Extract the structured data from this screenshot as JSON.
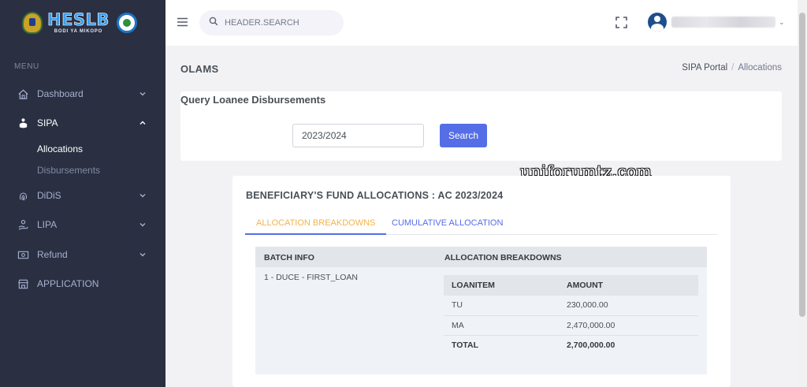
{
  "logo": {
    "title": "HESLB",
    "tagline": "BODI YA MIKOPO"
  },
  "sidebar": {
    "menu_title": "MENU",
    "items": [
      {
        "label": "Dashboard",
        "icon": "home-icon",
        "expanded": false
      },
      {
        "label": "SIPA",
        "icon": "sipa-person-icon",
        "expanded": true,
        "children": [
          {
            "label": "Allocations",
            "active": true
          },
          {
            "label": "Disbursements",
            "active": false
          }
        ]
      },
      {
        "label": "DiDiS",
        "icon": "fingerprint-icon",
        "expanded": false
      },
      {
        "label": "LIPA",
        "icon": "hand-coin-icon",
        "expanded": false
      },
      {
        "label": "Refund",
        "icon": "money-icon",
        "expanded": false
      },
      {
        "label": "APPLICATION",
        "icon": "store-icon"
      }
    ]
  },
  "header": {
    "search_placeholder": "HEADER.SEARCH"
  },
  "page": {
    "title": "OLAMS",
    "breadcrumb": {
      "parent": "SIPA Portal",
      "separator": "/",
      "current": "Allocations"
    }
  },
  "query": {
    "title": "Query Loanee Disbursements",
    "year_value": "2023/2024",
    "search_label": "Search"
  },
  "allocations": {
    "title": "BENEFICIARY'S FUND ALLOCATIONS : AC 2023/2024",
    "tabs": [
      {
        "label": "ALLOCATION BREAKDOWNS",
        "active": true
      },
      {
        "label": "CUMULATIVE ALLOCATION",
        "active": false
      }
    ],
    "columns": {
      "batch": "BATCH INFO",
      "breakdown": "ALLOCATION BREAKDOWNS"
    },
    "batch_info": "1 - DUCE - FIRST_LOAN",
    "inner_columns": {
      "item": "LOANITEM",
      "amount": "AMOUNT"
    },
    "rows": [
      {
        "item": "TU",
        "amount": "230,000.00"
      },
      {
        "item": "MA",
        "amount": "2,470,000.00"
      }
    ],
    "total": {
      "item": "TOTAL",
      "amount": "2,700,000.00"
    }
  },
  "watermark": "uniforumtz.com",
  "colors": {
    "sidebar_bg": "#2a3042",
    "primary": "#556ee6",
    "active_tab": "#f1b44c",
    "page_bg": "#f2f2f5"
  }
}
